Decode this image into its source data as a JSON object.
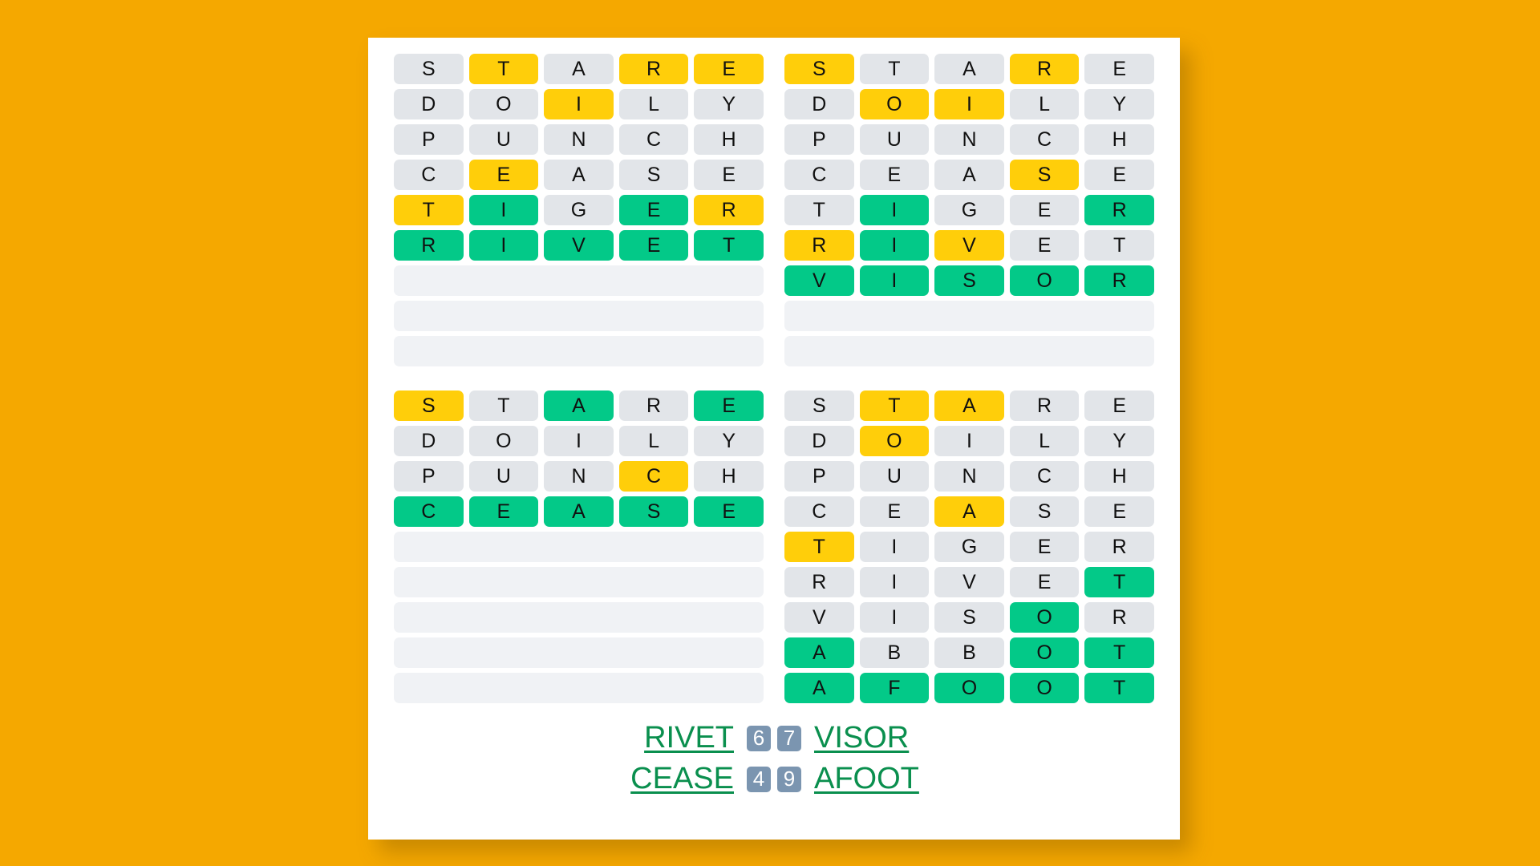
{
  "page": {
    "background_color": "#F5A800",
    "card_color": "#FFFFFF"
  },
  "colors": {
    "absent": "#E2E5E9",
    "present": "#FFCE0A",
    "correct": "#03C988",
    "blank_row": "#F0F2F5",
    "answer_link": "#0A8F4E",
    "badge": "#7B95B0"
  },
  "boards": [
    {
      "name": "board-top-left",
      "answer": "RIVET",
      "guess_count": 6,
      "total_rows": 9,
      "rows": [
        {
          "letters": [
            "S",
            "T",
            "A",
            "R",
            "E"
          ],
          "states": [
            "absent",
            "present",
            "absent",
            "present",
            "present"
          ]
        },
        {
          "letters": [
            "D",
            "O",
            "I",
            "L",
            "Y"
          ],
          "states": [
            "absent",
            "absent",
            "present",
            "absent",
            "absent"
          ]
        },
        {
          "letters": [
            "P",
            "U",
            "N",
            "C",
            "H"
          ],
          "states": [
            "absent",
            "absent",
            "absent",
            "absent",
            "absent"
          ]
        },
        {
          "letters": [
            "C",
            "E",
            "A",
            "S",
            "E"
          ],
          "states": [
            "absent",
            "present",
            "absent",
            "absent",
            "absent"
          ]
        },
        {
          "letters": [
            "T",
            "I",
            "G",
            "E",
            "R"
          ],
          "states": [
            "present",
            "correct",
            "absent",
            "correct",
            "present"
          ]
        },
        {
          "letters": [
            "R",
            "I",
            "V",
            "E",
            "T"
          ],
          "states": [
            "correct",
            "correct",
            "correct",
            "correct",
            "correct"
          ]
        }
      ],
      "blank_rows": 3
    },
    {
      "name": "board-top-right",
      "answer": "VISOR",
      "guess_count": 7,
      "total_rows": 9,
      "rows": [
        {
          "letters": [
            "S",
            "T",
            "A",
            "R",
            "E"
          ],
          "states": [
            "present",
            "absent",
            "absent",
            "present",
            "absent"
          ]
        },
        {
          "letters": [
            "D",
            "O",
            "I",
            "L",
            "Y"
          ],
          "states": [
            "absent",
            "present",
            "present",
            "absent",
            "absent"
          ]
        },
        {
          "letters": [
            "P",
            "U",
            "N",
            "C",
            "H"
          ],
          "states": [
            "absent",
            "absent",
            "absent",
            "absent",
            "absent"
          ]
        },
        {
          "letters": [
            "C",
            "E",
            "A",
            "S",
            "E"
          ],
          "states": [
            "absent",
            "absent",
            "absent",
            "present",
            "absent"
          ]
        },
        {
          "letters": [
            "T",
            "I",
            "G",
            "E",
            "R"
          ],
          "states": [
            "absent",
            "correct",
            "absent",
            "absent",
            "correct"
          ]
        },
        {
          "letters": [
            "R",
            "I",
            "V",
            "E",
            "T"
          ],
          "states": [
            "present",
            "correct",
            "present",
            "absent",
            "absent"
          ]
        },
        {
          "letters": [
            "V",
            "I",
            "S",
            "O",
            "R"
          ],
          "states": [
            "correct",
            "correct",
            "correct",
            "correct",
            "correct"
          ]
        }
      ],
      "blank_rows": 2
    },
    {
      "name": "board-bottom-left",
      "answer": "CEASE",
      "guess_count": 4,
      "total_rows": 9,
      "rows": [
        {
          "letters": [
            "S",
            "T",
            "A",
            "R",
            "E"
          ],
          "states": [
            "present",
            "absent",
            "correct",
            "absent",
            "correct"
          ]
        },
        {
          "letters": [
            "D",
            "O",
            "I",
            "L",
            "Y"
          ],
          "states": [
            "absent",
            "absent",
            "absent",
            "absent",
            "absent"
          ]
        },
        {
          "letters": [
            "P",
            "U",
            "N",
            "C",
            "H"
          ],
          "states": [
            "absent",
            "absent",
            "absent",
            "present",
            "absent"
          ]
        },
        {
          "letters": [
            "C",
            "E",
            "A",
            "S",
            "E"
          ],
          "states": [
            "correct",
            "correct",
            "correct",
            "correct",
            "correct"
          ]
        }
      ],
      "blank_rows": 5
    },
    {
      "name": "board-bottom-right",
      "answer": "AFOOT",
      "guess_count": 9,
      "total_rows": 9,
      "rows": [
        {
          "letters": [
            "S",
            "T",
            "A",
            "R",
            "E"
          ],
          "states": [
            "absent",
            "present",
            "present",
            "absent",
            "absent"
          ]
        },
        {
          "letters": [
            "D",
            "O",
            "I",
            "L",
            "Y"
          ],
          "states": [
            "absent",
            "present",
            "absent",
            "absent",
            "absent"
          ]
        },
        {
          "letters": [
            "P",
            "U",
            "N",
            "C",
            "H"
          ],
          "states": [
            "absent",
            "absent",
            "absent",
            "absent",
            "absent"
          ]
        },
        {
          "letters": [
            "C",
            "E",
            "A",
            "S",
            "E"
          ],
          "states": [
            "absent",
            "absent",
            "present",
            "absent",
            "absent"
          ]
        },
        {
          "letters": [
            "T",
            "I",
            "G",
            "E",
            "R"
          ],
          "states": [
            "present",
            "absent",
            "absent",
            "absent",
            "absent"
          ]
        },
        {
          "letters": [
            "R",
            "I",
            "V",
            "E",
            "T"
          ],
          "states": [
            "absent",
            "absent",
            "absent",
            "absent",
            "correct"
          ]
        },
        {
          "letters": [
            "V",
            "I",
            "S",
            "O",
            "R"
          ],
          "states": [
            "absent",
            "absent",
            "absent",
            "correct",
            "absent"
          ]
        },
        {
          "letters": [
            "A",
            "B",
            "B",
            "O",
            "T"
          ],
          "states": [
            "correct",
            "absent",
            "absent",
            "correct",
            "correct"
          ]
        },
        {
          "letters": [
            "A",
            "F",
            "O",
            "O",
            "T"
          ],
          "states": [
            "correct",
            "correct",
            "correct",
            "correct",
            "correct"
          ]
        }
      ],
      "blank_rows": 0
    }
  ],
  "answers_footer": {
    "lines": [
      {
        "left_word": "RIVET",
        "left_count": "6",
        "right_count": "7",
        "right_word": "VISOR"
      },
      {
        "left_word": "CEASE",
        "left_count": "4",
        "right_count": "9",
        "right_word": "AFOOT"
      }
    ]
  }
}
